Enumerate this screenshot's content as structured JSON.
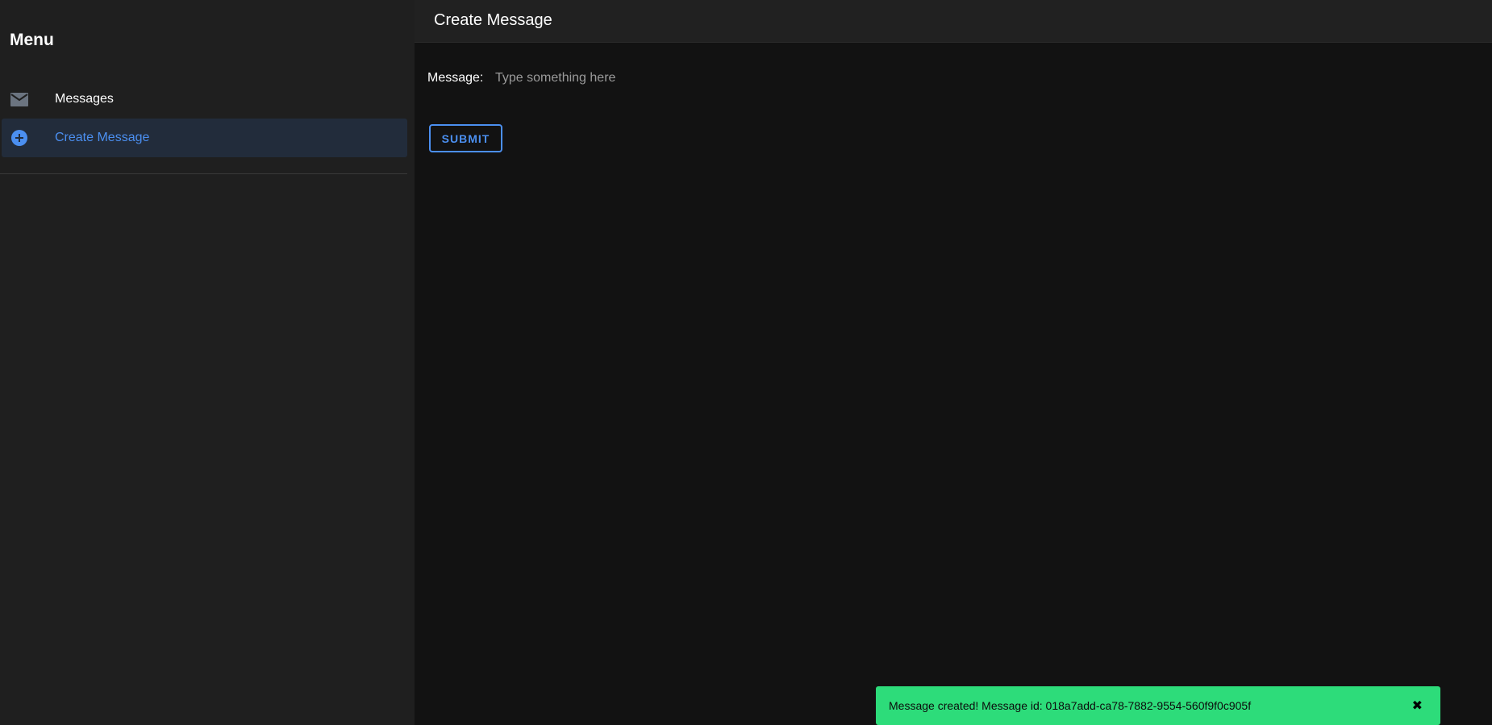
{
  "sidebar": {
    "title": "Menu",
    "items": [
      {
        "label": "Messages",
        "icon": "mail-icon",
        "active": false
      },
      {
        "label": "Create Message",
        "icon": "add-circle-icon",
        "active": true
      }
    ]
  },
  "header": {
    "title": "Create Message"
  },
  "form": {
    "message_label": "Message:",
    "message_value": "",
    "message_placeholder": "Type something here",
    "submit_label": "SUBMIT"
  },
  "toast": {
    "text": "Message created! Message id: 018a7add-ca78-7882-9554-560f9f0c905f",
    "close_icon": "✖"
  },
  "colors": {
    "accent": "#4b8ff0",
    "toast_bg": "#2ddc7a",
    "sidebar_bg": "#1f1f1f",
    "main_bg": "#121212"
  }
}
